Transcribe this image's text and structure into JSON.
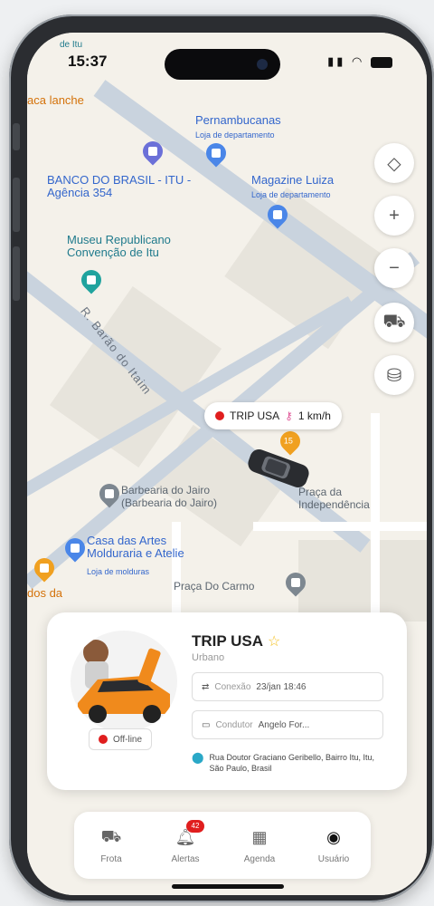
{
  "status_bar": {
    "top_left_label": "de Itu",
    "time": "15:37"
  },
  "map": {
    "labels": {
      "lanche": "aca lanche",
      "pernambucanas": "Pernambucanas",
      "pernambucanas_sub": "Loja de departamento",
      "banco": "BANCO DO BRASIL - ITU - Agência 354",
      "magazine": "Magazine Luiza",
      "magazine_sub": "Loja de departamento",
      "museu": "Museu Republicano Convenção de Itu",
      "street": "R. Barão do Itaim",
      "barbearia": "Barbearia do Jairo (Barbearia do Jairo)",
      "casa_artes": "Casa das Artes Molduraria e Atelie",
      "casa_artes_sub": "Loja de molduras",
      "praca_carmo": "Praça Do Carmo",
      "praca_indep": "Praça da Independência",
      "dos_da": "dos da"
    },
    "route_badge": "15"
  },
  "map_controls": [
    {
      "name": "locate-icon",
      "glyph": "◇"
    },
    {
      "name": "zoom-in-icon",
      "glyph": "+"
    },
    {
      "name": "zoom-out-icon",
      "glyph": "−"
    },
    {
      "name": "traffic-icon",
      "glyph": "⛟"
    },
    {
      "name": "layers-icon",
      "glyph": "⛁"
    }
  ],
  "vehicle_tag": {
    "name": "TRIP USA",
    "speed": "1 km/h"
  },
  "vehicle_card": {
    "title": "TRIP USA",
    "subtitle": "Urbano",
    "status": "Off-line",
    "connection_label": "Conexão",
    "connection_value": "23/jan 18:46",
    "driver_label": "Condutor",
    "driver_value": "Angelo For...",
    "address": "Rua Doutor Graciano Geribello, Bairro Itu, Itu, São Paulo, Brasil"
  },
  "bottom_nav": [
    {
      "label": "Frota",
      "active": false
    },
    {
      "label": "Alertas",
      "active": false,
      "badge": "42"
    },
    {
      "label": "Agenda",
      "active": false
    },
    {
      "label": "Usuário",
      "active": true
    }
  ],
  "colors": {
    "accent_red": "#e01e1e",
    "map_teal": "#1f7a8c",
    "map_blue": "#3366cc",
    "star": "#f4c020"
  }
}
